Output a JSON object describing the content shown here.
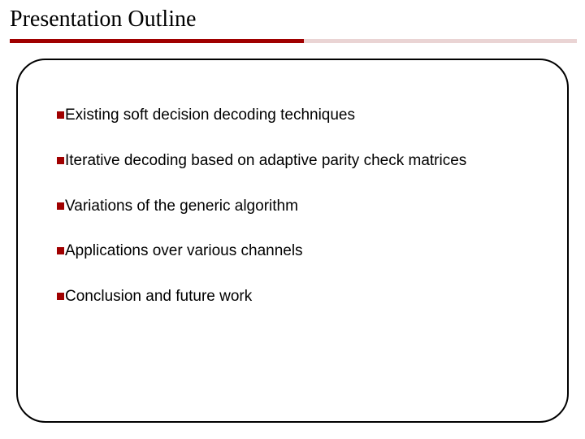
{
  "title": "Presentation Outline",
  "bullets": [
    "Existing soft decision decoding techniques",
    "Iterative decoding based on adaptive parity check matrices",
    "Variations of the generic algorithm",
    "Applications over various channels",
    "Conclusion and future work"
  ],
  "accent_color": "#a00000"
}
